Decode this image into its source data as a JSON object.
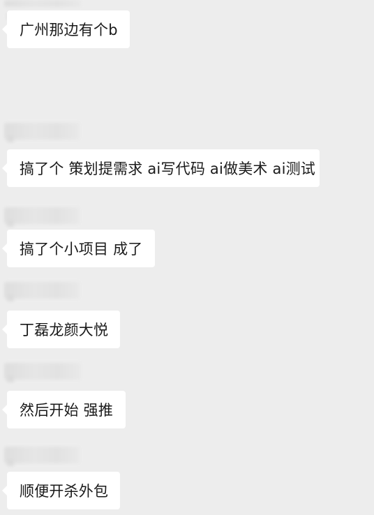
{
  "messages": [
    {
      "text": "广州那边有个b"
    },
    {
      "text": "搞了个 策划提需求 ai写代码 ai做美术 ai测试"
    },
    {
      "text": "搞了个小项目 成了"
    },
    {
      "text": "丁磊龙颜大悦"
    },
    {
      "text": "然后开始 强推"
    },
    {
      "text": "顺便开杀外包"
    }
  ]
}
